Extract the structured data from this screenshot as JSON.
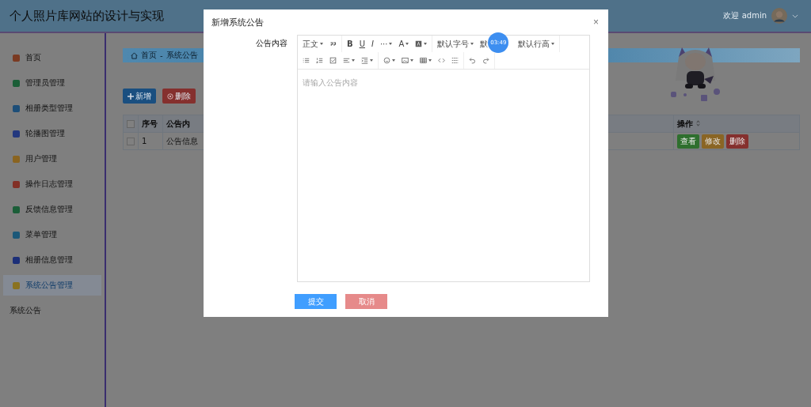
{
  "header": {
    "title": "个人照片库网站的设计与实现",
    "welcome": "欢迎 admin"
  },
  "sidebar": {
    "items": [
      {
        "label": "首页",
        "color": "#7a3a22",
        "selected": false,
        "kind": "icon"
      },
      {
        "label": "管理员管理",
        "color": "#1b5e37",
        "selected": false,
        "kind": "icon"
      },
      {
        "label": "相册类型管理",
        "color": "#1d4e78",
        "selected": false,
        "kind": "icon"
      },
      {
        "label": "轮播图管理",
        "color": "#23387e",
        "selected": false,
        "kind": "icon"
      },
      {
        "label": "用户管理",
        "color": "#8a6420",
        "selected": false,
        "kind": "icon"
      },
      {
        "label": "操作日志管理",
        "color": "#823026",
        "selected": false,
        "kind": "icon"
      },
      {
        "label": "反馈信息管理",
        "color": "#1b5e38",
        "selected": false,
        "kind": "icon"
      },
      {
        "label": "菜单管理",
        "color": "#1c5878",
        "selected": false,
        "kind": "icon"
      },
      {
        "label": "相册信息管理",
        "color": "#1c2f78",
        "selected": false,
        "kind": "icon"
      },
      {
        "label": "系统公告管理",
        "color": "#8a7220",
        "selected": true,
        "kind": "icon"
      },
      {
        "label": "系统公告",
        "selected": false,
        "kind": "plain"
      }
    ]
  },
  "breadcrumb": [
    "首页",
    "-",
    "系统公告"
  ],
  "actions": [
    {
      "label": "新增",
      "kind": "add"
    },
    {
      "label": "删除",
      "kind": "delete"
    }
  ],
  "table": {
    "all_checked": false,
    "columns": [
      "序号",
      "公告内",
      "操作"
    ],
    "rows": [
      {
        "checked": false,
        "index": "1",
        "content": "公告信息",
        "buttons": [
          {
            "label": "查看",
            "kind": "view"
          },
          {
            "label": "修改",
            "kind": "edit"
          },
          {
            "label": "删除",
            "kind": "delete"
          }
        ]
      }
    ]
  },
  "dialog": {
    "title": "新增系统公告",
    "close": "×",
    "field_label": "公告内容",
    "toolbar": [
      [
        {
          "kind": "text",
          "label": "正文",
          "dropdown": true
        },
        {
          "kind": "icon",
          "dropdown": false
        }
      ],
      [
        {
          "kind": "glyph",
          "label": "B",
          "dropdown": false
        },
        {
          "kind": "glyph",
          "label": "U",
          "dropdown": false
        },
        {
          "kind": "glyph",
          "label": "I",
          "dropdown": false
        },
        {
          "kind": "glyph",
          "label": "···",
          "dropdown": true
        },
        {
          "kind": "glyph",
          "label": "A",
          "dropdown": true
        },
        {
          "kind": "icon",
          "dropdown": true
        }
      ],
      [
        {
          "kind": "text",
          "label": "默认字号",
          "dropdown": true
        },
        {
          "kind": "text",
          "label": "默",
          "dropdown": false
        },
        {
          "kind": "text",
          "label": "默认行高",
          "dropdown": true
        }
      ],
      [
        {
          "kind": "icon",
          "dropdown": false
        },
        {
          "kind": "icon",
          "dropdown": false
        },
        {
          "kind": "icon",
          "dropdown": false
        },
        {
          "kind": "icon",
          "dropdown": true
        },
        {
          "kind": "icon",
          "dropdown": true
        }
      ],
      [
        {
          "kind": "icon",
          "dropdown": true
        },
        {
          "kind": "icon",
          "dropdown": true
        },
        {
          "kind": "icon",
          "dropdown": true
        },
        {
          "kind": "icon",
          "dropdown": false
        },
        {
          "kind": "icon",
          "dropdown": false
        }
      ],
      [
        {
          "kind": "icon",
          "dropdown": false
        },
        {
          "kind": "icon",
          "dropdown": false
        }
      ]
    ],
    "placeholder": "请输入公告内容",
    "timer": "03:49",
    "buttons": [
      {
        "label": "提交",
        "kind": "primary"
      },
      {
        "label": "取消",
        "kind": "cancel"
      }
    ]
  }
}
